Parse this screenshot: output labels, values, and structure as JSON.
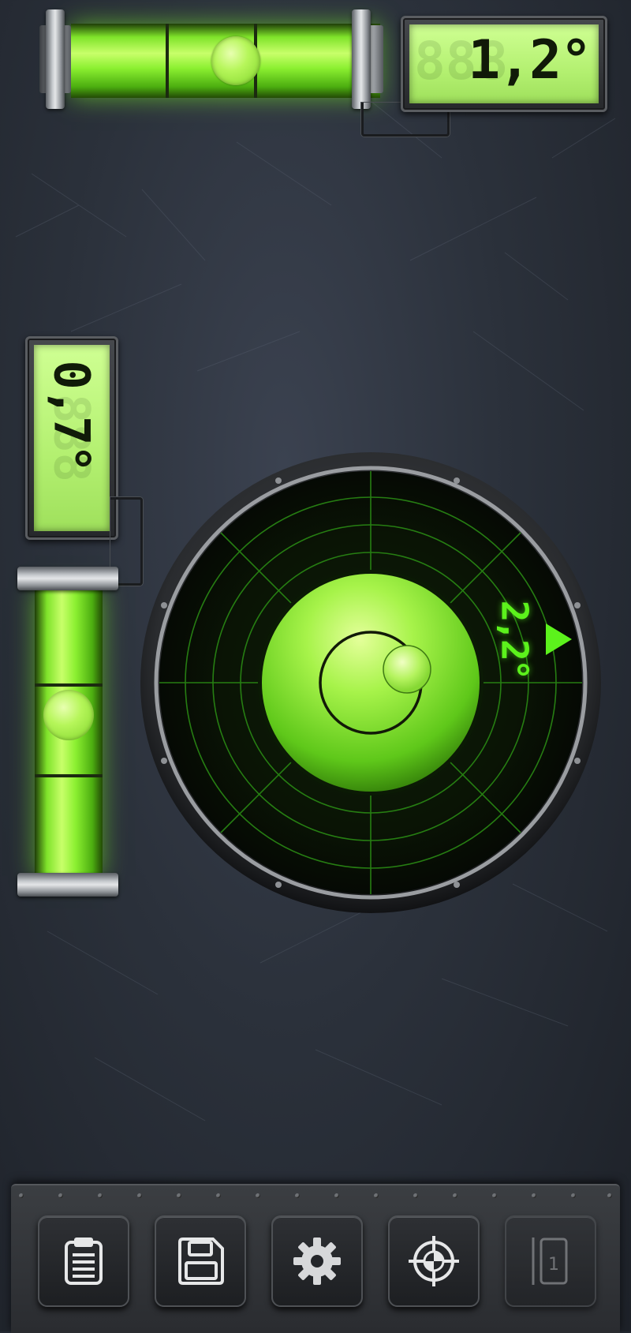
{
  "horizontal_level": {
    "reading": "1,2°"
  },
  "vertical_level": {
    "reading": "0,7°"
  },
  "bullseye_level": {
    "reading": "2,2°"
  },
  "toolbar": {
    "buttons": [
      {
        "icon": "clipboard-icon"
      },
      {
        "icon": "save-icon"
      },
      {
        "icon": "gear-icon"
      },
      {
        "icon": "crosshair-icon"
      },
      {
        "icon": "phone-mode-icon",
        "label": "1"
      }
    ]
  },
  "colors": {
    "accent": "#5cf21c",
    "lcd": "#b3f070",
    "panel": "#2b313b"
  }
}
